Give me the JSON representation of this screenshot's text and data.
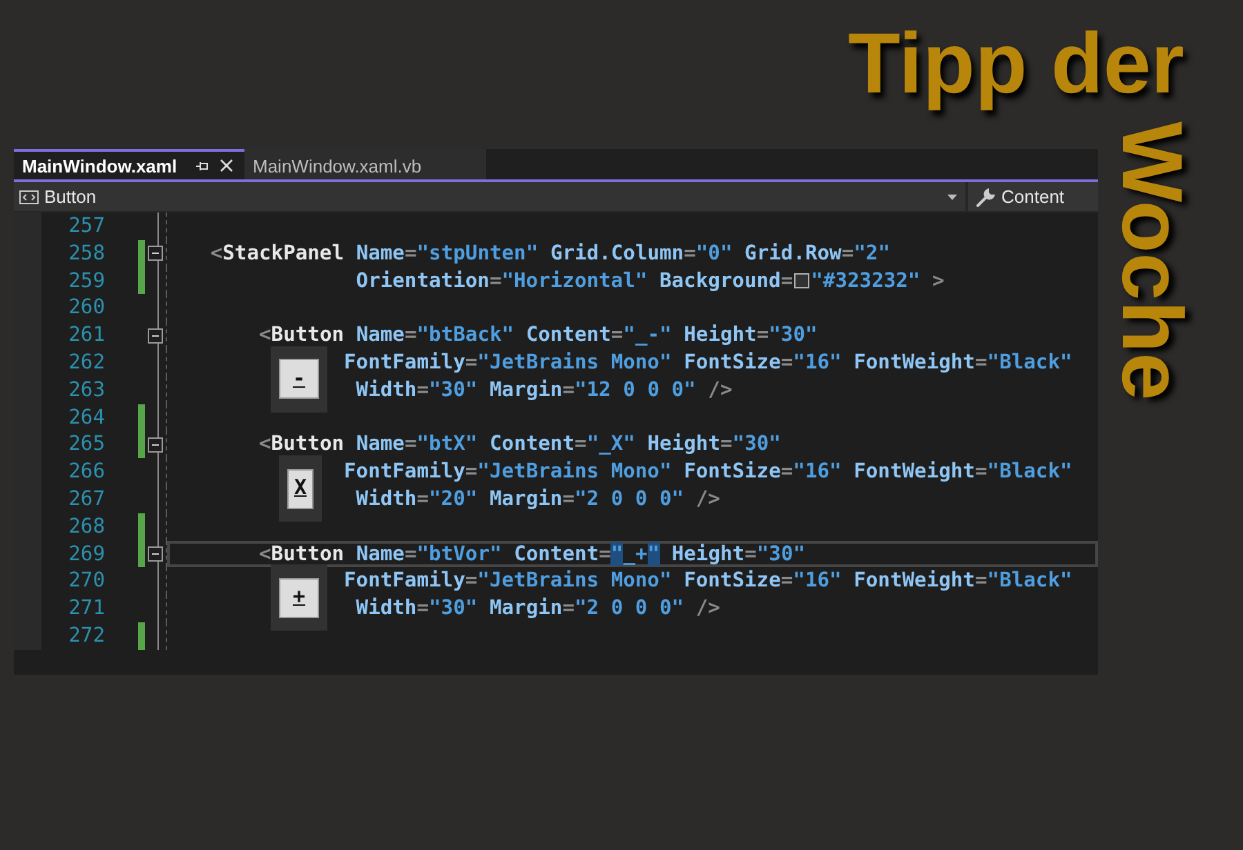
{
  "banner": {
    "line_1": "Tipp der",
    "line_2": "Woche"
  },
  "tabs": [
    {
      "label": "MainWindow.xaml",
      "selected": true
    },
    {
      "label": "MainWindow.xaml.vb",
      "selected": false
    }
  ],
  "nav_bar": {
    "element": "Button",
    "member": "Content"
  },
  "lines": [
    {
      "number": "257",
      "changed": false,
      "fold": false,
      "current": false
    },
    {
      "number": "258",
      "changed": true,
      "fold": true,
      "current": false,
      "kind": "root_tag",
      "tag": {
        "open": "<",
        "name": "StackPanel"
      },
      "attrs": [
        {
          "name": "Name",
          "eq": "=",
          "value": "\"stpUnten\""
        },
        {
          "name": "Grid.Column",
          "eq": "=",
          "value": "\"0\""
        },
        {
          "name": "Grid.Row",
          "eq": "=",
          "value": "\"2\""
        }
      ]
    },
    {
      "number": "259",
      "changed": true,
      "fold": false,
      "current": false,
      "kind": "root_attrs",
      "attrs": [
        {
          "name": "Orientation",
          "eq": "=",
          "value": "\"Horizontal\""
        },
        {
          "name": "Background",
          "eq": "=",
          "value": "\"#323232\"",
          "color": "#323232"
        }
      ],
      "close": ">"
    },
    {
      "number": "260",
      "changed": false,
      "fold": false,
      "current": false
    },
    {
      "number": "261",
      "changed": false,
      "fold": true,
      "current": false,
      "kind": "child_tag",
      "tag": {
        "open": "<",
        "name": "Button"
      },
      "attrs": [
        {
          "name": "Name",
          "eq": "=",
          "value": "\"btBack\""
        },
        {
          "name": "Content",
          "eq": "=",
          "value": "\"_-\""
        },
        {
          "name": "Height",
          "eq": "=",
          "value": "\"30\""
        }
      ]
    },
    {
      "number": "262",
      "changed": false,
      "fold": false,
      "current": false,
      "kind": "child_attrs",
      "attrs": [
        {
          "name": "FontFamily",
          "eq": "=",
          "value": "\"JetBrains Mono\""
        },
        {
          "name": "FontSize",
          "eq": "=",
          "value": "\"16\""
        },
        {
          "name": "FontWeight",
          "eq": "=",
          "value": "\"Black\""
        }
      ],
      "preview": {
        "label": "-",
        "kind": "wide"
      }
    },
    {
      "number": "263",
      "changed": false,
      "fold": false,
      "current": false,
      "kind": "child_attrs_end",
      "attrs": [
        {
          "name": "Width",
          "eq": "=",
          "value": "\"30\""
        },
        {
          "name": "Margin",
          "eq": "=",
          "value": "\"12 0 0 0\""
        }
      ],
      "close": "/>"
    },
    {
      "number": "264",
      "changed": true,
      "fold": false,
      "current": false
    },
    {
      "number": "265",
      "changed": true,
      "fold": true,
      "current": false,
      "kind": "child_tag",
      "tag": {
        "open": "<",
        "name": "Button"
      },
      "attrs": [
        {
          "name": "Name",
          "eq": "=",
          "value": "\"btX\""
        },
        {
          "name": "Content",
          "eq": "=",
          "value": "\"_X\""
        },
        {
          "name": "Height",
          "eq": "=",
          "value": "\"30\""
        }
      ]
    },
    {
      "number": "266",
      "changed": false,
      "fold": false,
      "current": false,
      "kind": "child_attrs",
      "attrs": [
        {
          "name": "FontFamily",
          "eq": "=",
          "value": "\"JetBrains Mono\""
        },
        {
          "name": "FontSize",
          "eq": "=",
          "value": "\"16\""
        },
        {
          "name": "FontWeight",
          "eq": "=",
          "value": "\"Black\""
        }
      ],
      "preview": {
        "label": "X",
        "kind": "narrow"
      }
    },
    {
      "number": "267",
      "changed": false,
      "fold": false,
      "current": false,
      "kind": "child_attrs_end",
      "attrs": [
        {
          "name": "Width",
          "eq": "=",
          "value": "\"20\""
        },
        {
          "name": "Margin",
          "eq": "=",
          "value": "\"2 0 0 0\""
        }
      ],
      "close": "/>"
    },
    {
      "number": "268",
      "changed": true,
      "fold": false,
      "current": false
    },
    {
      "number": "269",
      "changed": true,
      "fold": true,
      "current": true,
      "kind": "child_tag",
      "tag": {
        "open": "<",
        "name": "Button"
      },
      "attrs": [
        {
          "name": "Name",
          "eq": "=",
          "value": "\"btVor\""
        },
        {
          "name": "Content",
          "eq": "=",
          "value": "\"_+\"",
          "quotes_matched": true
        },
        {
          "name": "Height",
          "eq": "=",
          "value": "\"30\""
        }
      ]
    },
    {
      "number": "270",
      "changed": false,
      "fold": false,
      "current": false,
      "kind": "child_attrs",
      "attrs": [
        {
          "name": "FontFamily",
          "eq": "=",
          "value": "\"JetBrains Mono\""
        },
        {
          "name": "FontSize",
          "eq": "=",
          "value": "\"16\""
        },
        {
          "name": "FontWeight",
          "eq": "=",
          "value": "\"Black\""
        }
      ],
      "preview": {
        "label": "+",
        "kind": "wide"
      }
    },
    {
      "number": "271",
      "changed": false,
      "fold": false,
      "current": false,
      "kind": "child_attrs_end",
      "attrs": [
        {
          "name": "Width",
          "eq": "=",
          "value": "\"30\""
        },
        {
          "name": "Margin",
          "eq": "=",
          "value": "\"2 0 0 0\""
        }
      ],
      "close": "/>"
    },
    {
      "number": "272",
      "changed": true,
      "fold": false,
      "current": false
    }
  ]
}
